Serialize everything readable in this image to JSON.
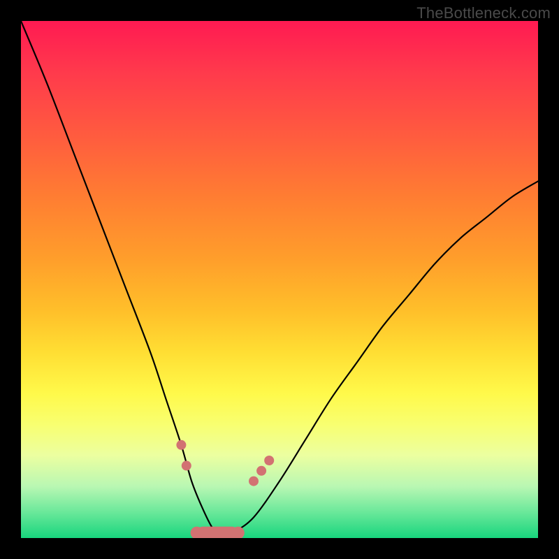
{
  "watermark": "TheBottleneck.com",
  "colors": {
    "frame": "#000000",
    "curve": "#000000",
    "marker": "#d27272",
    "gradient_stops": [
      "#ff1a52",
      "#ff3a4c",
      "#ff5b3f",
      "#ff7d32",
      "#ff9e2b",
      "#ffbf2a",
      "#ffde33",
      "#fff94a",
      "#f8ff70",
      "#ecffa0",
      "#b9f7b3",
      "#6ae89a",
      "#18d57d"
    ]
  },
  "chart_data": {
    "type": "line",
    "title": "",
    "xlabel": "",
    "ylabel": "",
    "xlim": [
      0,
      100
    ],
    "ylim": [
      0,
      100
    ],
    "grid": false,
    "legend": false,
    "series": [
      {
        "name": "curve",
        "x": [
          0,
          5,
          10,
          15,
          20,
          25,
          28,
          31,
          33,
          35,
          37,
          39,
          41,
          45,
          50,
          55,
          60,
          65,
          70,
          75,
          80,
          85,
          90,
          95,
          100
        ],
        "values": [
          100,
          88,
          75,
          62,
          49,
          36,
          27,
          18,
          11,
          6,
          2,
          0,
          1,
          4,
          11,
          19,
          27,
          34,
          41,
          47,
          53,
          58,
          62,
          66,
          69
        ]
      }
    ],
    "markers_left": [
      {
        "x": 31,
        "y": 18
      },
      {
        "x": 32,
        "y": 14
      }
    ],
    "markers_right": [
      {
        "x": 45,
        "y": 11
      },
      {
        "x": 46.5,
        "y": 13
      },
      {
        "x": 48,
        "y": 15
      }
    ],
    "bottom_cluster": {
      "x_start": 34,
      "x_end": 42,
      "y": 1
    }
  }
}
